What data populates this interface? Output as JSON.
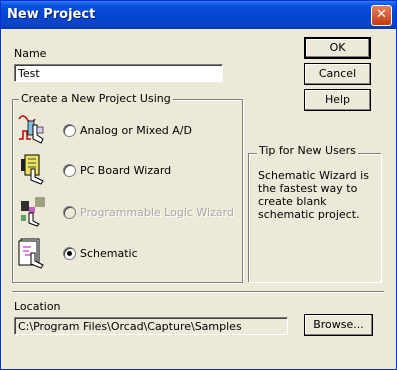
{
  "window": {
    "title": "New Project",
    "close": "✕"
  },
  "name": {
    "label": "Name",
    "value": "Test"
  },
  "buttons": {
    "ok": "OK",
    "cancel": "Cancel",
    "help": "Help",
    "browse": "Browse..."
  },
  "group": {
    "title": "Create a New Project Using",
    "options": [
      {
        "label": "Analog or Mixed A/D",
        "icon": "analog-icon",
        "selected": false,
        "enabled": true
      },
      {
        "label": "PC Board Wizard",
        "icon": "pc-board-icon",
        "selected": false,
        "enabled": true
      },
      {
        "label": "Programmable Logic Wizard",
        "icon": "programmable-logic-icon",
        "selected": false,
        "enabled": false
      },
      {
        "label": "Schematic",
        "icon": "schematic-icon",
        "selected": true,
        "enabled": true
      }
    ]
  },
  "tips": {
    "title": "Tip for New Users",
    "text": "Schematic Wizard is the fastest way to create blank schematic project."
  },
  "location": {
    "label": "Location",
    "value": "C:\\Program Files\\Orcad\\Capture\\Samples"
  }
}
